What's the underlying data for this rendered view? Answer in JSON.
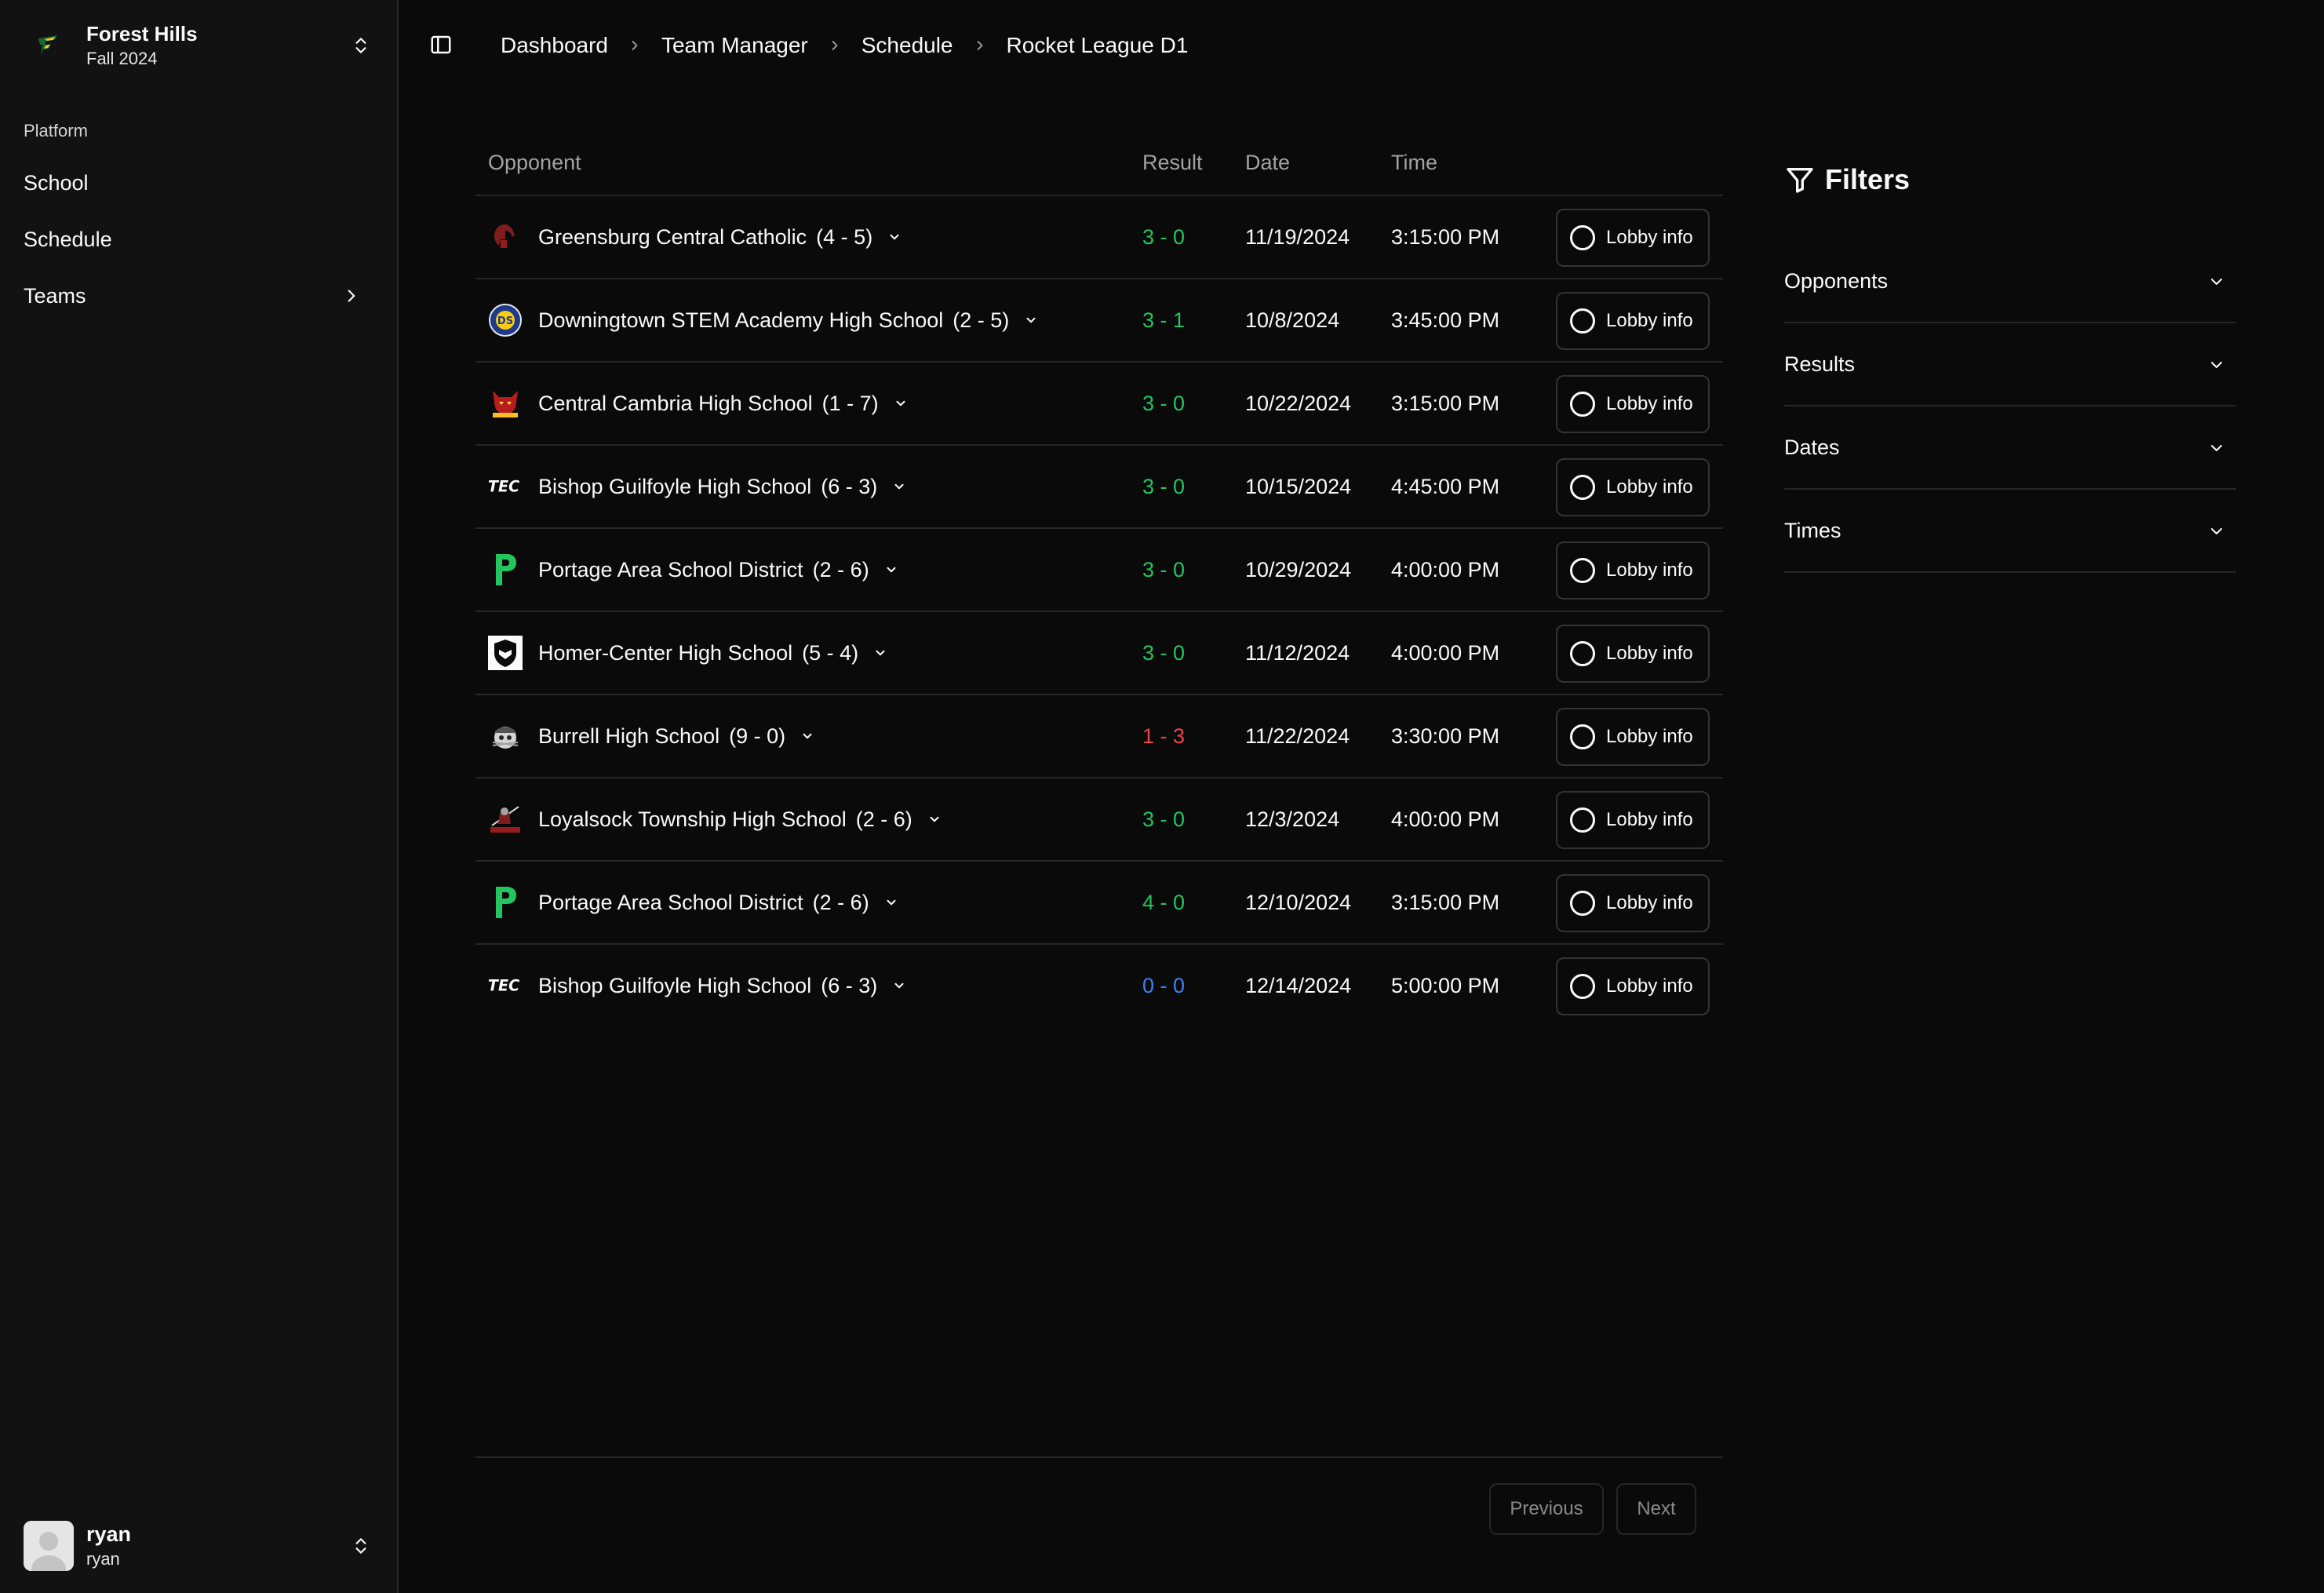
{
  "sidebar": {
    "org": {
      "name": "Forest Hills",
      "season": "Fall 2024"
    },
    "group_label": "Platform",
    "nav": [
      {
        "label": "School"
      },
      {
        "label": "Schedule"
      },
      {
        "label": "Teams"
      }
    ],
    "user": {
      "name": "ryan",
      "handle": "ryan"
    }
  },
  "breadcrumb": [
    "Dashboard",
    "Team Manager",
    "Schedule",
    "Rocket League D1"
  ],
  "table": {
    "headers": {
      "opponent": "Opponent",
      "result": "Result",
      "date": "Date",
      "time": "Time"
    },
    "lobby_label": "Lobby info",
    "rows": [
      {
        "opponent": "Greensburg Central Catholic",
        "record": "(4 - 5)",
        "result": "3 - 0",
        "status": "win",
        "date": "11/19/2024",
        "time": "3:15:00 PM",
        "logo": "spartan-helmet-icon"
      },
      {
        "opponent": "Downingtown STEM Academy High School",
        "record": "(2 - 5)",
        "result": "3 - 1",
        "status": "win",
        "date": "10/8/2024",
        "time": "3:45:00 PM",
        "logo": "stem-seal-icon"
      },
      {
        "opponent": "Central Cambria High School",
        "record": "(1 - 7)",
        "result": "3 - 0",
        "status": "win",
        "date": "10/22/2024",
        "time": "3:15:00 PM",
        "logo": "inferno-demon-icon"
      },
      {
        "opponent": "Bishop Guilfoyle High School",
        "record": "(6 - 3)",
        "result": "3 - 0",
        "status": "win",
        "date": "10/15/2024",
        "time": "4:45:00 PM",
        "logo": "tec-wordmark-icon"
      },
      {
        "opponent": "Portage Area School District",
        "record": "(2 - 6)",
        "result": "3 - 0",
        "status": "win",
        "date": "10/29/2024",
        "time": "4:00:00 PM",
        "logo": "green-p-icon"
      },
      {
        "opponent": "Homer-Center High School",
        "record": "(5 - 4)",
        "result": "3 - 0",
        "status": "win",
        "date": "11/12/2024",
        "time": "4:00:00 PM",
        "logo": "shield-crest-icon"
      },
      {
        "opponent": "Burrell High School",
        "record": "(9 - 0)",
        "result": "1 - 3",
        "status": "loss",
        "date": "11/22/2024",
        "time": "3:30:00 PM",
        "logo": "pirate-icon"
      },
      {
        "opponent": "Loyalsock Township High School",
        "record": "(2 - 6)",
        "result": "3 - 0",
        "status": "win",
        "date": "12/3/2024",
        "time": "4:00:00 PM",
        "logo": "lancers-icon"
      },
      {
        "opponent": "Portage Area School District",
        "record": "(2 - 6)",
        "result": "4 - 0",
        "status": "win",
        "date": "12/10/2024",
        "time": "3:15:00 PM",
        "logo": "green-p-icon"
      },
      {
        "opponent": "Bishop Guilfoyle High School",
        "record": "(6 - 3)",
        "result": "0 - 0",
        "status": "pending",
        "date": "12/14/2024",
        "time": "5:00:00 PM",
        "logo": "tec-wordmark-icon"
      }
    ]
  },
  "pagination": {
    "previous": "Previous",
    "next": "Next"
  },
  "filters": {
    "title": "Filters",
    "items": [
      "Opponents",
      "Results",
      "Dates",
      "Times"
    ]
  },
  "colors": {
    "win": "#22c55e",
    "loss": "#ef4444",
    "pending": "#3b82f6",
    "background": "#0a0a0a",
    "sidebar": "#121212"
  }
}
